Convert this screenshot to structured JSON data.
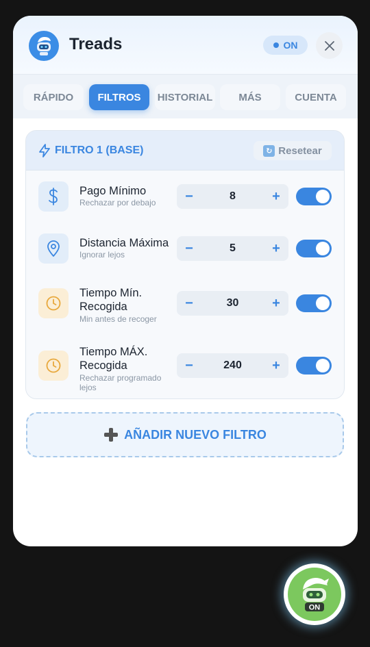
{
  "app": {
    "title": "Treads",
    "status": "ON",
    "avatar_icon": "robot-icon",
    "accent": "#3a86e0"
  },
  "tabs": [
    {
      "label": "RÁPIDO",
      "active": false
    },
    {
      "label": "FILTROS",
      "active": true
    },
    {
      "label": "HISTORIAL",
      "active": false
    },
    {
      "label": "MÁS",
      "active": false
    },
    {
      "label": "CUENTA",
      "active": false
    }
  ],
  "filter": {
    "title": "FILTRO 1 (BASE)",
    "reset_label": "Resetear",
    "rows": [
      {
        "icon": "dollar-icon",
        "title": "Pago Mínimo",
        "subtitle": "Rechazar por debajo",
        "value": "8",
        "minus": "−",
        "plus": "+",
        "enabled": true
      },
      {
        "icon": "location-pin-icon",
        "title": "Distancia Máxima",
        "subtitle": "Ignorar lejos",
        "value": "5",
        "minus": "−",
        "plus": "+",
        "enabled": true
      },
      {
        "icon": "clock-icon",
        "title": "Tiempo Mín. Recogida",
        "subtitle": "Min antes de recoger",
        "value": "30",
        "minus": "−",
        "plus": "+",
        "enabled": true
      },
      {
        "icon": "clock-icon",
        "title": "Tiempo MÁX. Recogida",
        "subtitle": "Rechazar programado lejos",
        "value": "240",
        "minus": "−",
        "plus": "+",
        "enabled": true
      }
    ]
  },
  "add_filter_label": "AÑADIR NUEVO FILTRO",
  "fab": {
    "label": "ON",
    "color": "#7cc85e"
  }
}
